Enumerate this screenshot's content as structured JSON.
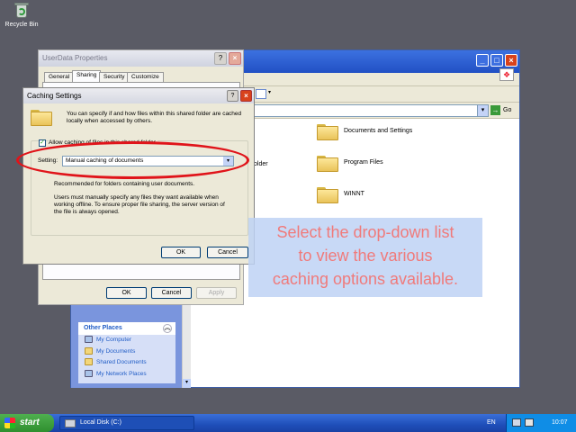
{
  "desktop": {
    "recycle_bin_label": "Recycle Bin"
  },
  "explorer": {
    "go_label": "Go",
    "folders": [
      "Documents and Settings",
      "Program Files",
      "WINNT"
    ],
    "partial_folder_label": "older",
    "other_places": {
      "header": "Other Places",
      "items": [
        "My Computer",
        "My Documents",
        "Shared Documents",
        "My Network Places"
      ]
    }
  },
  "properties_dialog": {
    "title": "UserData Properties",
    "tabs": [
      "General",
      "Sharing",
      "Security",
      "Customize"
    ],
    "active_tab": "Sharing",
    "ok": "OK",
    "cancel": "Cancel",
    "apply": "Apply"
  },
  "caching_dialog": {
    "title": "Caching Settings",
    "description_line1": "You can specify if and how files within this shared folder are cached",
    "description_line2": "locally when accessed by others.",
    "allow_caching_label": "Allow caching of files in this shared folder",
    "allow_caching_checked": true,
    "setting_label": "Setting:",
    "setting_value": "Manual caching of documents",
    "recommended_text": "Recommended for folders containing user documents.",
    "note_line1": "Users must manually specify any files they want available when",
    "note_line2": "working offline.  To ensure proper file sharing, the server version of",
    "note_line3": "the file is always opened.",
    "ok": "OK",
    "cancel": "Cancel"
  },
  "callout": {
    "line1": "Select the drop-down list",
    "line2": "to view the various",
    "line3": "caching options available."
  },
  "taskbar": {
    "start_label": "start",
    "task_label": "Local Disk (C:)",
    "language": "EN",
    "clock": "10:07"
  }
}
